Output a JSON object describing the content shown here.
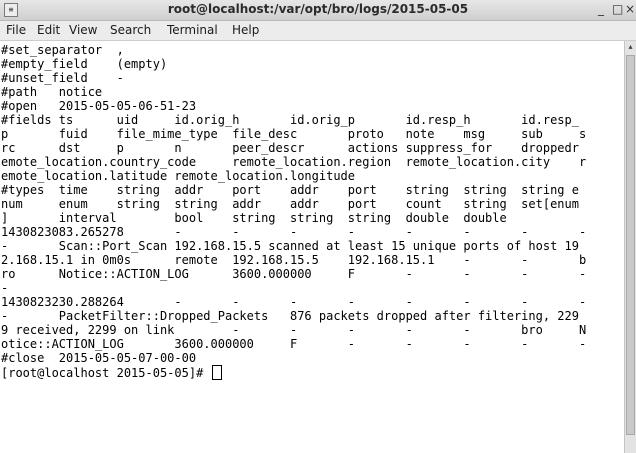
{
  "window": {
    "title": "root@localhost:/var/opt/bro/logs/2015-05-05",
    "icon_glyph": "≡",
    "minimize_glyph": "_",
    "maximize_glyph": "□",
    "close_glyph": "×"
  },
  "menu": {
    "items": [
      {
        "label": "File"
      },
      {
        "label": "Edit"
      },
      {
        "label": "View"
      },
      {
        "label": "Search"
      },
      {
        "label": "Terminal"
      },
      {
        "label": "Help"
      }
    ]
  },
  "terminal": {
    "lines": [
      "#set_separator\t,",
      "#empty_field\t(empty)",
      "#unset_field\t-",
      "#path\tnotice",
      "#open\t2015-05-05-06-51-23",
      "#fields ts      uid     id.orig_h       id.orig_p       id.resp_h       id.resp_",
      "p       fuid    file_mime_type  file_desc       proto   note    msg     sub     s",
      "rc      dst     p       n       peer_descr      actions suppress_for    droppedr",
      "emote_location.country_code     remote_location.region  remote_location.city    r",
      "emote_location.latitude remote_location.longitude",
      "#types  time    string  addr    port    addr    port    string  string  string e",
      "num     enum    string  string  addr    addr    port    count   string  set[enum",
      "]       interval        bool    string  string  string  double  double",
      "1430823083.265278       -       -       -       -       -       -       -       -",
      "-       Scan::Port_Scan 192.168.15.5 scanned at least 15 unique ports of host 19",
      "2.168.15.1 in 0m0s      remote  192.168.15.5    192.168.15.1    -       -       b",
      "ro      Notice::ACTION_LOG      3600.000000     F       -       -       -       -",
      "-",
      "1430823230.288264       -       -       -       -       -       -       -       -",
      "-       PacketFilter::Dropped_Packets   876 packets dropped after filtering, 229",
      "9 received, 2299 on link        -       -       -       -       -       bro     N",
      "otice::ACTION_LOG       3600.000000     F       -       -       -       -       -",
      "#close  2015-05-05-07-00-00",
      "[root@localhost 2015-05-05]# "
    ]
  },
  "scrollbar": {
    "up_glyph": "▴"
  },
  "colors": {
    "terminal_bg": "#ffffff",
    "terminal_fg": "#000000",
    "chrome": "#ececec"
  }
}
